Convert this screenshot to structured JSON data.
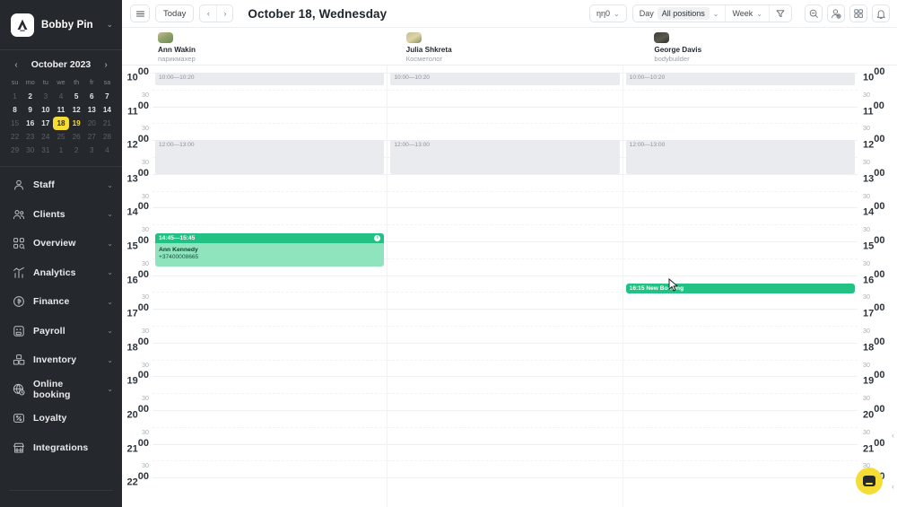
{
  "sidebar": {
    "brand": {
      "name": "Bobby Pin",
      "logo_icon": "brand-logo-icon",
      "chevron_icon": "chevron-down-icon"
    },
    "calendar": {
      "title": "October 2023",
      "prev_icon": "chevron-left-icon",
      "next_icon": "chevron-right-icon",
      "dow": [
        "su",
        "mo",
        "tu",
        "we",
        "th",
        "fr",
        "sa"
      ],
      "weeks": [
        [
          {
            "d": "1",
            "state": "muted"
          },
          {
            "d": "2",
            "state": "normal"
          },
          {
            "d": "3",
            "state": "muted"
          },
          {
            "d": "4",
            "state": "muted"
          },
          {
            "d": "5",
            "state": "normal"
          },
          {
            "d": "6",
            "state": "normal"
          },
          {
            "d": "7",
            "state": "normal"
          }
        ],
        [
          {
            "d": "8",
            "state": "normal"
          },
          {
            "d": "9",
            "state": "normal"
          },
          {
            "d": "10",
            "state": "normal"
          },
          {
            "d": "11",
            "state": "normal"
          },
          {
            "d": "12",
            "state": "normal"
          },
          {
            "d": "13",
            "state": "normal"
          },
          {
            "d": "14",
            "state": "normal"
          }
        ],
        [
          {
            "d": "15",
            "state": "muted"
          },
          {
            "d": "16",
            "state": "normal"
          },
          {
            "d": "17",
            "state": "normal"
          },
          {
            "d": "18",
            "state": "today"
          },
          {
            "d": "19",
            "state": "hl"
          },
          {
            "d": "20",
            "state": "muted"
          },
          {
            "d": "21",
            "state": "muted"
          }
        ],
        [
          {
            "d": "22",
            "state": "muted"
          },
          {
            "d": "23",
            "state": "muted"
          },
          {
            "d": "24",
            "state": "muted"
          },
          {
            "d": "25",
            "state": "muted"
          },
          {
            "d": "26",
            "state": "muted"
          },
          {
            "d": "27",
            "state": "muted"
          },
          {
            "d": "28",
            "state": "muted"
          }
        ],
        [
          {
            "d": "29",
            "state": "muted"
          },
          {
            "d": "30",
            "state": "muted"
          },
          {
            "d": "31",
            "state": "muted"
          },
          {
            "d": "1",
            "state": "muted"
          },
          {
            "d": "2",
            "state": "muted"
          },
          {
            "d": "3",
            "state": "muted"
          },
          {
            "d": "4",
            "state": "muted"
          }
        ]
      ]
    },
    "nav": [
      {
        "label": "Staff",
        "icon": "user-icon",
        "expandable": true
      },
      {
        "label": "Clients",
        "icon": "users-icon",
        "expandable": true
      },
      {
        "label": "Overview",
        "icon": "grid-search-icon",
        "expandable": true
      },
      {
        "label": "Analytics",
        "icon": "chart-bars-icon",
        "expandable": true
      },
      {
        "label": "Finance",
        "icon": "coin-icon",
        "expandable": true
      },
      {
        "label": "Payroll",
        "icon": "payroll-icon",
        "expandable": true
      },
      {
        "label": "Inventory",
        "icon": "boxes-icon",
        "expandable": true
      },
      {
        "label": "Online booking",
        "icon": "globe-clock-icon",
        "expandable": true
      },
      {
        "label": "Loyalty",
        "icon": "percent-card-icon",
        "expandable": false
      },
      {
        "label": "Integrations",
        "icon": "store-icon",
        "expandable": false
      }
    ]
  },
  "toolbar": {
    "menu_icon": "hamburger-menu-icon",
    "today_label": "Today",
    "prev_icon": "chevron-left-icon",
    "next_icon": "chevron-right-icon",
    "page_title": "October 18, Wednesday",
    "branch_label": "ηη0",
    "branch_chevron_icon": "chevron-down-icon",
    "view_label": "Day",
    "positions_label": "All positions",
    "positions_chevron_icon": "chevron-down-icon",
    "period_label": "Week",
    "period_chevron_icon": "chevron-down-icon",
    "filter_icon": "funnel-icon",
    "right_icons": [
      {
        "name": "search-icon"
      },
      {
        "name": "add-user-icon"
      },
      {
        "name": "apps-grid-icon"
      },
      {
        "name": "bell-icon"
      }
    ]
  },
  "staff": [
    {
      "name": "Ann Wakin",
      "role": "парикмахер",
      "avatar": "avatar-ann-wakin"
    },
    {
      "name": "Julia Shkreta",
      "role": "Косметолог",
      "avatar": "avatar-julia-shkreta"
    },
    {
      "name": "George Davis",
      "role": "bodybuilder",
      "avatar": "avatar-george-davis"
    }
  ],
  "time_ruler": {
    "hours": [
      "10",
      "11",
      "12",
      "13",
      "14",
      "15",
      "16",
      "17",
      "18",
      "19",
      "20",
      "21",
      "22"
    ],
    "hour_suffix": "00",
    "half_label": "30"
  },
  "schedule": {
    "blocked": [
      {
        "column": 0,
        "label": "10:00—10:20",
        "start": "10:00",
        "end": "10:20"
      },
      {
        "column": 0,
        "label": "12:00—13:00",
        "start": "12:00",
        "end": "13:00"
      },
      {
        "column": 1,
        "label": "10:00—10:20",
        "start": "10:00",
        "end": "10:20"
      },
      {
        "column": 1,
        "label": "12:00—13:00",
        "start": "12:00",
        "end": "13:00"
      },
      {
        "column": 2,
        "label": "10:00—10:20",
        "start": "10:00",
        "end": "10:20"
      },
      {
        "column": 2,
        "label": "12:00—13:00",
        "start": "12:00",
        "end": "13:00"
      }
    ],
    "appointment": {
      "column": 0,
      "time_label": "14:45—15:45",
      "client": "Ann Kennedy",
      "phone": "+37400008665",
      "status_icon": "info-dot-icon",
      "color": "#21c284"
    },
    "new_booking": {
      "column": 2,
      "label": "16:15 New Booking",
      "color": "#21c284"
    }
  },
  "fab": {
    "icon": "chat-widget-icon",
    "color": "#f5dd35"
  },
  "edge": {
    "chevron_icon": "chevron-left-icon"
  },
  "colors": {
    "sidebar_bg": "#25292e",
    "accent_yellow": "#f5dd35",
    "accent_green": "#21c284",
    "appointment_body": "#8fe3bd",
    "blocked_gray": "#e9ebee"
  }
}
